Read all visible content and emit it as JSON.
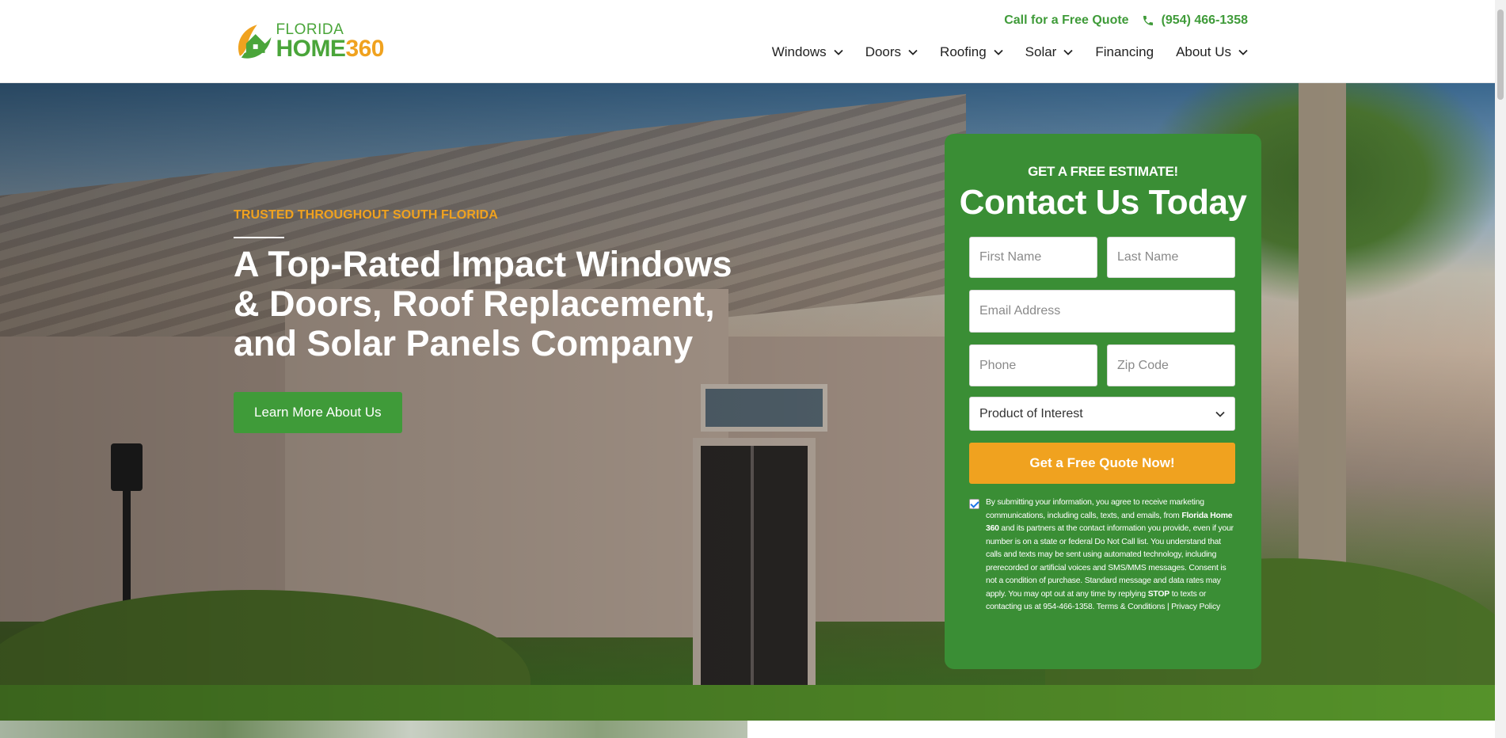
{
  "header": {
    "logo": {
      "line1": "FLORIDA",
      "line2_a": "HOME",
      "line2_b": "360"
    },
    "cta_text": "Call for a Free Quote",
    "phone": "(954) 466-1358",
    "nav": [
      {
        "label": "Windows",
        "dropdown": true
      },
      {
        "label": "Doors",
        "dropdown": true
      },
      {
        "label": "Roofing",
        "dropdown": true
      },
      {
        "label": "Solar",
        "dropdown": true
      },
      {
        "label": "Financing",
        "dropdown": false
      },
      {
        "label": "About Us",
        "dropdown": true
      }
    ]
  },
  "hero": {
    "eyebrow": "TRUSTED THROUGHOUT SOUTH FLORIDA",
    "headline_lines": [
      "A Top-Rated Impact Windows",
      "& Doors, Roof Replacement,",
      "and Solar Panels Company"
    ],
    "button": "Learn More About Us"
  },
  "form": {
    "kicker": "GET A FREE ESTIMATE!",
    "title": "Contact Us Today",
    "first_name_placeholder": "First Name",
    "last_name_placeholder": "Last Name",
    "email_placeholder": "Email Address",
    "phone_placeholder": "Phone",
    "zip_placeholder": "Zip Code",
    "product_select": "Product of Interest",
    "submit": "Get a Free Quote Now!",
    "consent_checked": true,
    "consent": {
      "part1": "By submitting your information, you agree to receive marketing communications, including calls, texts, and emails, from ",
      "brand": "Florida Home 360",
      "part2": " and its partners at the contact information you provide, even if your number is on a state or federal Do Not Call list. You understand that calls and texts may be sent using automated technology, including prerecorded or artificial voices and SMS/MMS messages. Consent is not a condition of purchase. Standard message and data rates may apply. You may opt out at any time by replying ",
      "stop": "STOP",
      "part3": " to texts or contacting us at 954-466-1358. ",
      "terms_link": "Terms & Conditions",
      "separator": " | ",
      "privacy_link": "Privacy Policy"
    }
  },
  "colors": {
    "brand_green": "#3f9b39",
    "form_green": "#3a8e35",
    "accent_orange": "#f0a21f"
  },
  "icons": [
    "house-leaf-logo-icon",
    "phone-icon",
    "chevron-down-icon"
  ]
}
